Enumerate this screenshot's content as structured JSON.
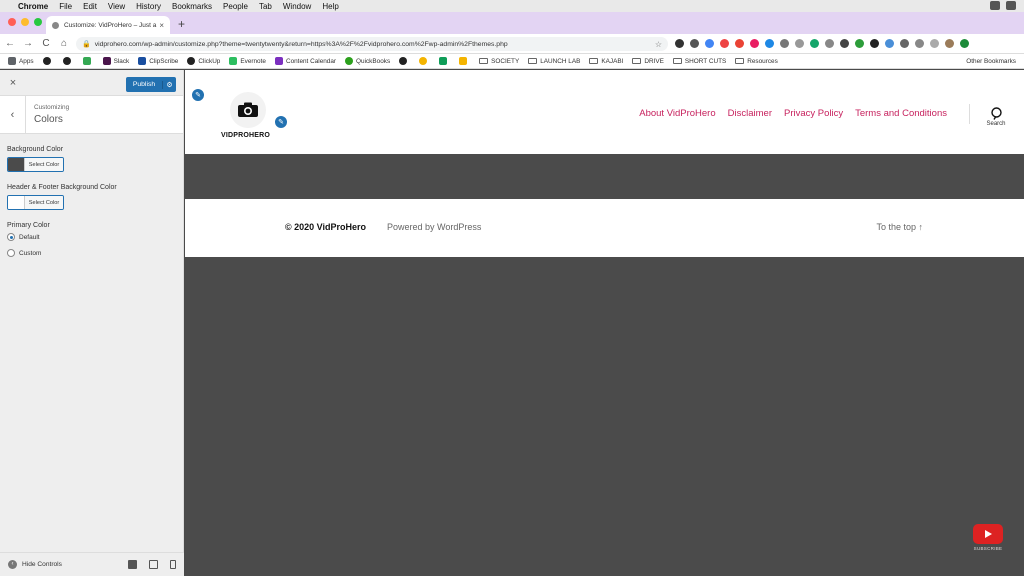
{
  "menubar": {
    "app": "Chrome",
    "items": [
      "File",
      "Edit",
      "View",
      "History",
      "Bookmarks",
      "People",
      "Tab",
      "Window",
      "Help"
    ]
  },
  "tab": {
    "title": "Customize: VidProHero – Just a",
    "close": "×",
    "new_tab": "+"
  },
  "toolbar": {
    "back": "←",
    "forward": "→",
    "reload": "C",
    "home": "⌂",
    "url": "vidprohero.com/wp-admin/customize.php?theme=twentytwenty&return=https%3A%2F%2Fvidprohero.com%2Fwp-admin%2Fthemes.php"
  },
  "bookmarks": {
    "items": [
      {
        "label": "Apps",
        "color": "#5f6368"
      },
      {
        "label": "",
        "color": "#222222"
      },
      {
        "label": "",
        "color": "#222222"
      },
      {
        "label": "",
        "color": "#34a853"
      },
      {
        "label": "Slack",
        "color": "#4a154b"
      },
      {
        "label": "ClipScribe",
        "color": "#1a4fa0"
      },
      {
        "label": "ClickUp",
        "color": "#222222"
      },
      {
        "label": "Evernote",
        "color": "#2dbe60"
      },
      {
        "label": "Content Calendar",
        "color": "#7b2fbf"
      },
      {
        "label": "QuickBooks",
        "color": "#2ca01c"
      },
      {
        "label": "",
        "color": "#222222"
      },
      {
        "label": "",
        "color": "#f4b400"
      },
      {
        "label": "",
        "color": "#0f9d58"
      },
      {
        "label": "",
        "color": "#f4b400"
      }
    ],
    "folders": [
      "SOCIETY",
      "LAUNCH LAB",
      "KAJABI",
      "DRIVE",
      "SHORT CUTS",
      "Resources"
    ],
    "other": "Other Bookmarks"
  },
  "customizer": {
    "close": "×",
    "publish_label": "Publish",
    "back": "‹",
    "section_small": "Customizing",
    "section_title": "Colors",
    "background_label": "Background Color",
    "background_swatch": "#4b4b4b",
    "hf_label": "Header & Footer Background Color",
    "hf_swatch": "#ffffff",
    "select_color": "Select Color",
    "primary_label": "Primary Color",
    "option_default": "Default",
    "option_custom": "Custom",
    "hide_controls": "Hide Controls"
  },
  "site": {
    "logo_text": "VIDPROHERO",
    "nav": [
      "About VidProHero",
      "Disclaimer",
      "Privacy Policy",
      "Terms and Conditions"
    ],
    "search_label": "Search",
    "copyright": "© 2020 VidProHero",
    "powered": "Powered by WordPress",
    "to_top": "To the top ↑",
    "primary_color": "#c7225e",
    "background_color": "#4b4b4b"
  },
  "overlay": {
    "subscribe": "SUBSCRIBE"
  }
}
